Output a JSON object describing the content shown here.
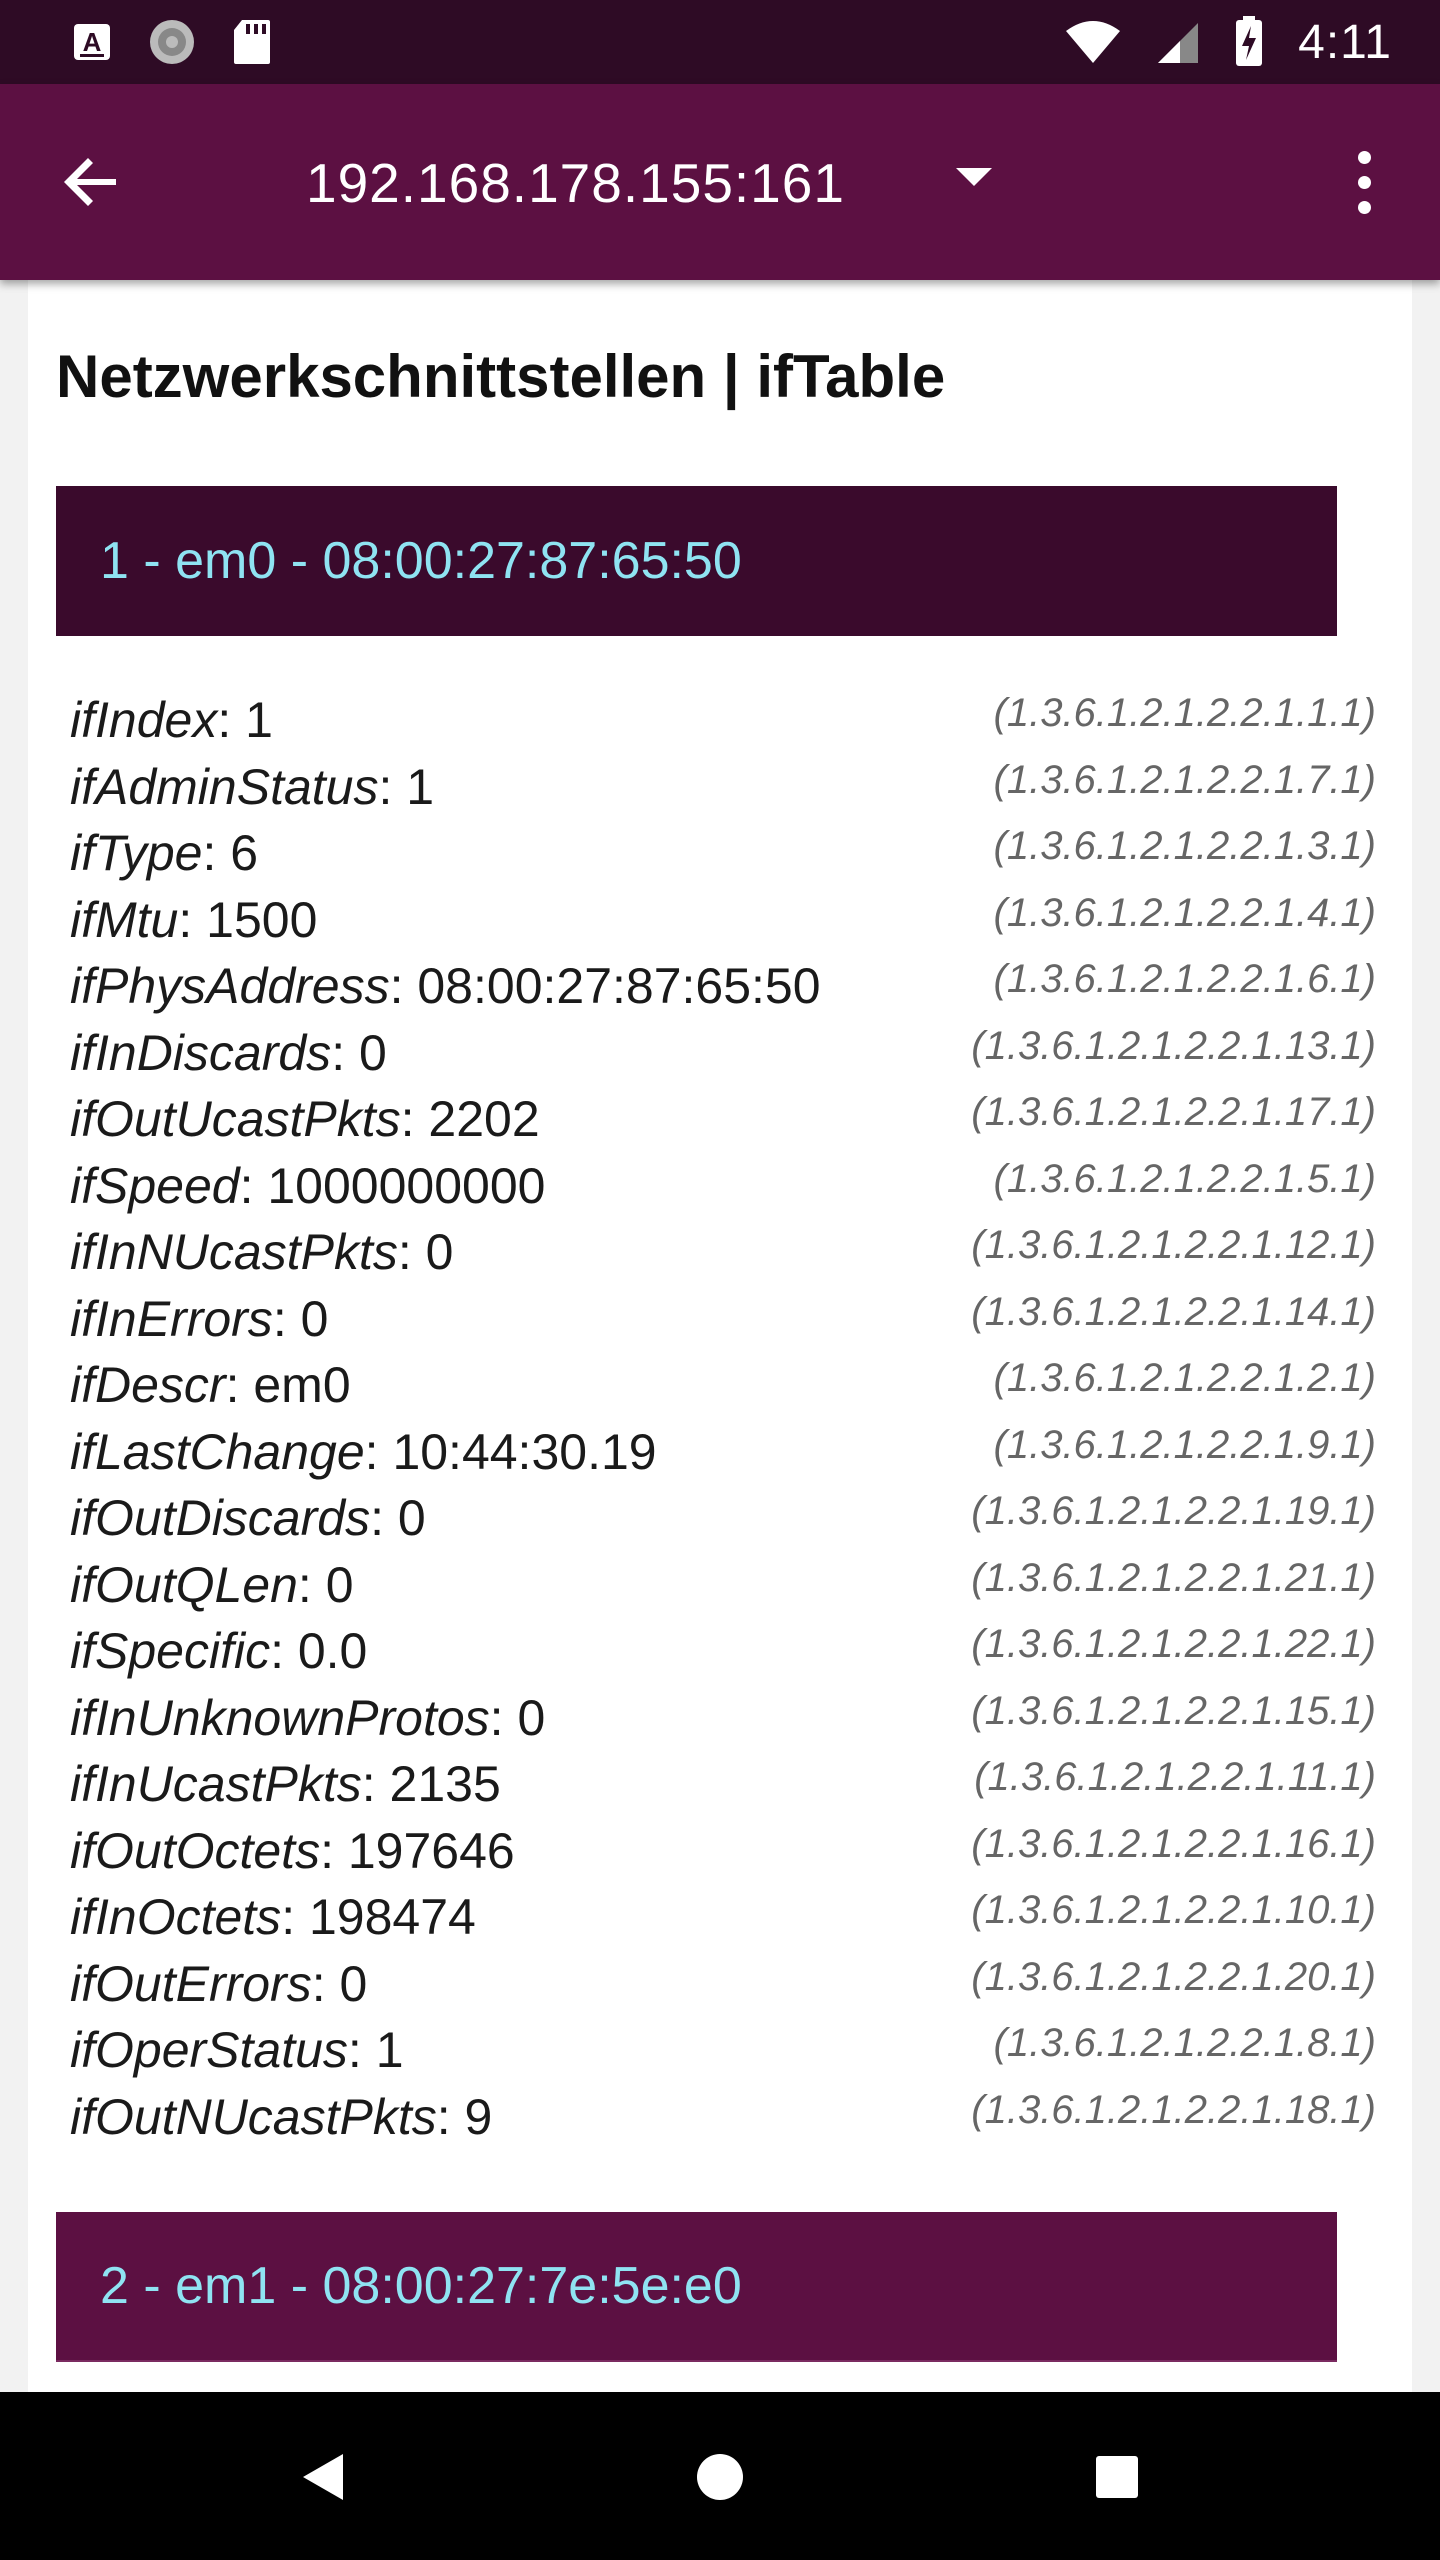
{
  "status_bar": {
    "time": "4:11",
    "left_icons": [
      "a-notification-icon",
      "sync-icon",
      "sd-card-icon"
    ],
    "right_icons": [
      "wifi-icon",
      "signal-icon",
      "battery-charging-icon"
    ]
  },
  "app_bar": {
    "host": "192.168.178.155:161"
  },
  "page": {
    "title": "Netzwerkschnittstellen | ifTable"
  },
  "interfaces": [
    {
      "header": "1 - em0 - 08:00:27:87:65:50",
      "properties": [
        {
          "name": "ifIndex",
          "value": ": 1",
          "oid": "(1.3.6.1.2.1.2.2.1.1.1)"
        },
        {
          "name": "ifAdminStatus",
          "value": ": 1",
          "oid": "(1.3.6.1.2.1.2.2.1.7.1)"
        },
        {
          "name": "ifType",
          "value": ": 6",
          "oid": "(1.3.6.1.2.1.2.2.1.3.1)"
        },
        {
          "name": "ifMtu",
          "value": ": 1500",
          "oid": "(1.3.6.1.2.1.2.2.1.4.1)"
        },
        {
          "name": "ifPhysAddress",
          "value": ": 08:00:27:87:65:50",
          "oid": "(1.3.6.1.2.1.2.2.1.6.1)"
        },
        {
          "name": "ifInDiscards",
          "value": ": 0",
          "oid": "(1.3.6.1.2.1.2.2.1.13.1)"
        },
        {
          "name": "ifOutUcastPkts",
          "value": ": 2202",
          "oid": "(1.3.6.1.2.1.2.2.1.17.1)"
        },
        {
          "name": "ifSpeed",
          "value": ": 1000000000",
          "oid": "(1.3.6.1.2.1.2.2.1.5.1)"
        },
        {
          "name": "ifInNUcastPkts",
          "value": ": 0",
          "oid": "(1.3.6.1.2.1.2.2.1.12.1)"
        },
        {
          "name": "ifInErrors",
          "value": ": 0",
          "oid": "(1.3.6.1.2.1.2.2.1.14.1)"
        },
        {
          "name": "ifDescr",
          "value": ": em0",
          "oid": "(1.3.6.1.2.1.2.2.1.2.1)"
        },
        {
          "name": "ifLastChange",
          "value": ": 10:44:30.19",
          "oid": "(1.3.6.1.2.1.2.2.1.9.1)"
        },
        {
          "name": "ifOutDiscards",
          "value": ": 0",
          "oid": "(1.3.6.1.2.1.2.2.1.19.1)"
        },
        {
          "name": "ifOutQLen",
          "value": ": 0",
          "oid": "(1.3.6.1.2.1.2.2.1.21.1)"
        },
        {
          "name": "ifSpecific",
          "value": ": 0.0",
          "oid": "(1.3.6.1.2.1.2.2.1.22.1)"
        },
        {
          "name": "ifInUnknownProtos",
          "value": ": 0",
          "oid": "(1.3.6.1.2.1.2.2.1.15.1)"
        },
        {
          "name": "ifInUcastPkts",
          "value": ": 2135",
          "oid": "(1.3.6.1.2.1.2.2.1.11.1)"
        },
        {
          "name": "ifOutOctets",
          "value": ": 197646",
          "oid": "(1.3.6.1.2.1.2.2.1.16.1)"
        },
        {
          "name": "ifInOctets",
          "value": ": 198474",
          "oid": "(1.3.6.1.2.1.2.2.1.10.1)"
        },
        {
          "name": "ifOutErrors",
          "value": ": 0",
          "oid": "(1.3.6.1.2.1.2.2.1.20.1)"
        },
        {
          "name": "ifOperStatus",
          "value": ": 1",
          "oid": "(1.3.6.1.2.1.2.2.1.8.1)"
        },
        {
          "name": "ifOutNUcastPkts",
          "value": ": 9",
          "oid": "(1.3.6.1.2.1.2.2.1.18.1)"
        }
      ]
    },
    {
      "header": "2 - em1 - 08:00:27:7e:5e:e0"
    }
  ],
  "nav_bar": {
    "icons": [
      "back-triangle-icon",
      "home-circle-icon",
      "recents-square-icon"
    ]
  },
  "colors": {
    "status_bar": "#2e0b25",
    "app_bar": "#5c1042",
    "header_dark": "#3a0a2c",
    "header_text": "#8fe3f2"
  }
}
